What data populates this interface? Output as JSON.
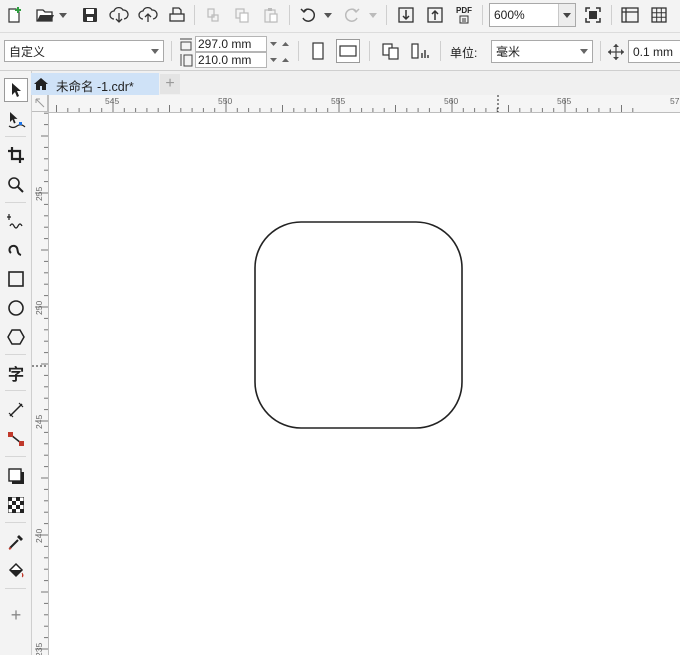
{
  "toolbar": {
    "pdf_label": "PDF",
    "zoom_value": "600%"
  },
  "property_bar": {
    "page_preset": "自定义",
    "width_value": "297.0 mm",
    "height_value": "210.0 mm",
    "units_label": "单位:",
    "units_value": "毫米",
    "nudge_value": "0.1 mm"
  },
  "document": {
    "tab_title": "未命名 -1.cdr*",
    "add_tab_label": "+"
  },
  "rulers": {
    "horizontal_ticks": [
      "545",
      "550",
      "555",
      "560",
      "565",
      "57"
    ],
    "vertical_ticks": [
      "255",
      "250",
      "245",
      "240",
      "235"
    ]
  },
  "toolbox": {
    "text_tool_glyph": "字",
    "add_tool_label": "+"
  },
  "colors": {
    "tab_active": "#cfe2f7",
    "shape_stroke": "#222222",
    "accent_green": "#2e9e3e"
  }
}
